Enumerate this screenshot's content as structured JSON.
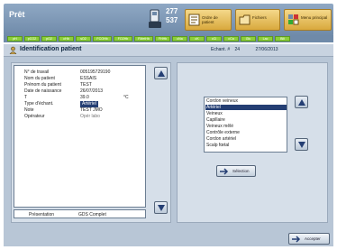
{
  "status": {
    "title": "Prêt",
    "count_top": "277",
    "count_bottom": "537"
  },
  "toolbar": {
    "buttons": [
      {
        "label": "Ordre de patient"
      },
      {
        "label": "Fichiers"
      },
      {
        "label": "Menu principal"
      }
    ]
  },
  "tabs": [
    "pH",
    "pCO2",
    "pO2",
    "cHb",
    "sO2",
    "FCOHb",
    "FO2Hb",
    "FMetHb",
    "FHHb",
    "cNa",
    "cK",
    "cCl",
    "cCa",
    "Glu",
    "Lac",
    "Bili"
  ],
  "section": {
    "title": "Identification patient",
    "exam_label": "Echant. #",
    "exam_number": "24",
    "exam_date": "27/06/2013"
  },
  "patient_fields": [
    {
      "label": "N° de travail",
      "value": "005195729190"
    },
    {
      "label": "Nom du patient",
      "value": "ESSAIS"
    },
    {
      "label": "Prénom du patient",
      "value": "TEST"
    },
    {
      "label": "Date de naissance",
      "value": "26/07/2013"
    },
    {
      "label": "T",
      "value": "39.0",
      "unit": "°C"
    },
    {
      "label": "Type d'échant.",
      "value": "Artériel"
    },
    {
      "label": "Note",
      "value": "TEST JMO"
    },
    {
      "label": "Opérateur",
      "value": "Opér labo"
    }
  ],
  "presentation": {
    "label": "Présentation",
    "value": "GDS Complet"
  },
  "sample_types": {
    "options": [
      "Cordon veineux",
      "Artériel",
      "Veineux",
      "Capillaire",
      "Veineux mêlé",
      "Contrôle externe",
      "Cordon artériel",
      "Scalp fœtal"
    ],
    "selected_index": 1
  },
  "buttons": {
    "select": "Sélection",
    "next": "Accepter"
  },
  "colors": {
    "selection": "#243e73",
    "tab": "#8ccf3a",
    "toolbar": "#d9a93d"
  }
}
